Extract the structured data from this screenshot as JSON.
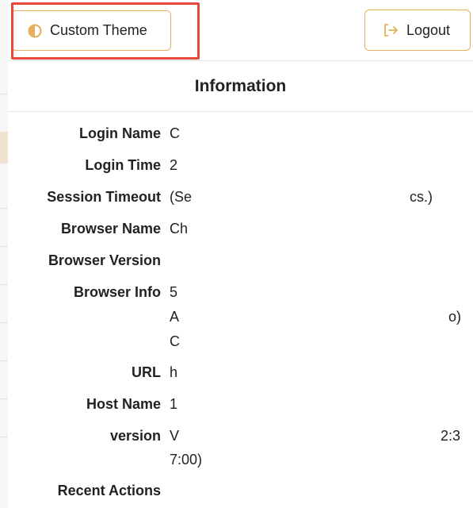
{
  "toolbar": {
    "theme_label": "Custom Theme",
    "logout_label": "Logout",
    "theme_icon": "half-circle-icon",
    "logout_icon": "logout-arrow-icon",
    "accent_color": "#e4b15a",
    "highlight_color": "#e54a3a"
  },
  "panel": {
    "title": "Information",
    "rows": [
      {
        "key": "Login Name",
        "value": "C"
      },
      {
        "key": "Login Time",
        "value": "2"
      },
      {
        "key": "Session Timeout",
        "value": "(Se",
        "value_tail": "cs.)"
      },
      {
        "key": "Browser Name",
        "value": "Ch"
      },
      {
        "key": "Browser Version",
        "value": ""
      },
      {
        "key": "Browser Info",
        "value": "5",
        "line2": "A",
        "line2_tail": "o)",
        "line3": "C"
      },
      {
        "key": "URL",
        "value": "h"
      },
      {
        "key": "Host Name",
        "value": "1"
      },
      {
        "key": "version",
        "value": "V",
        "value_tail": "2:3",
        "line2": "7:00)"
      },
      {
        "key": "Recent Actions",
        "value": ""
      }
    ]
  }
}
